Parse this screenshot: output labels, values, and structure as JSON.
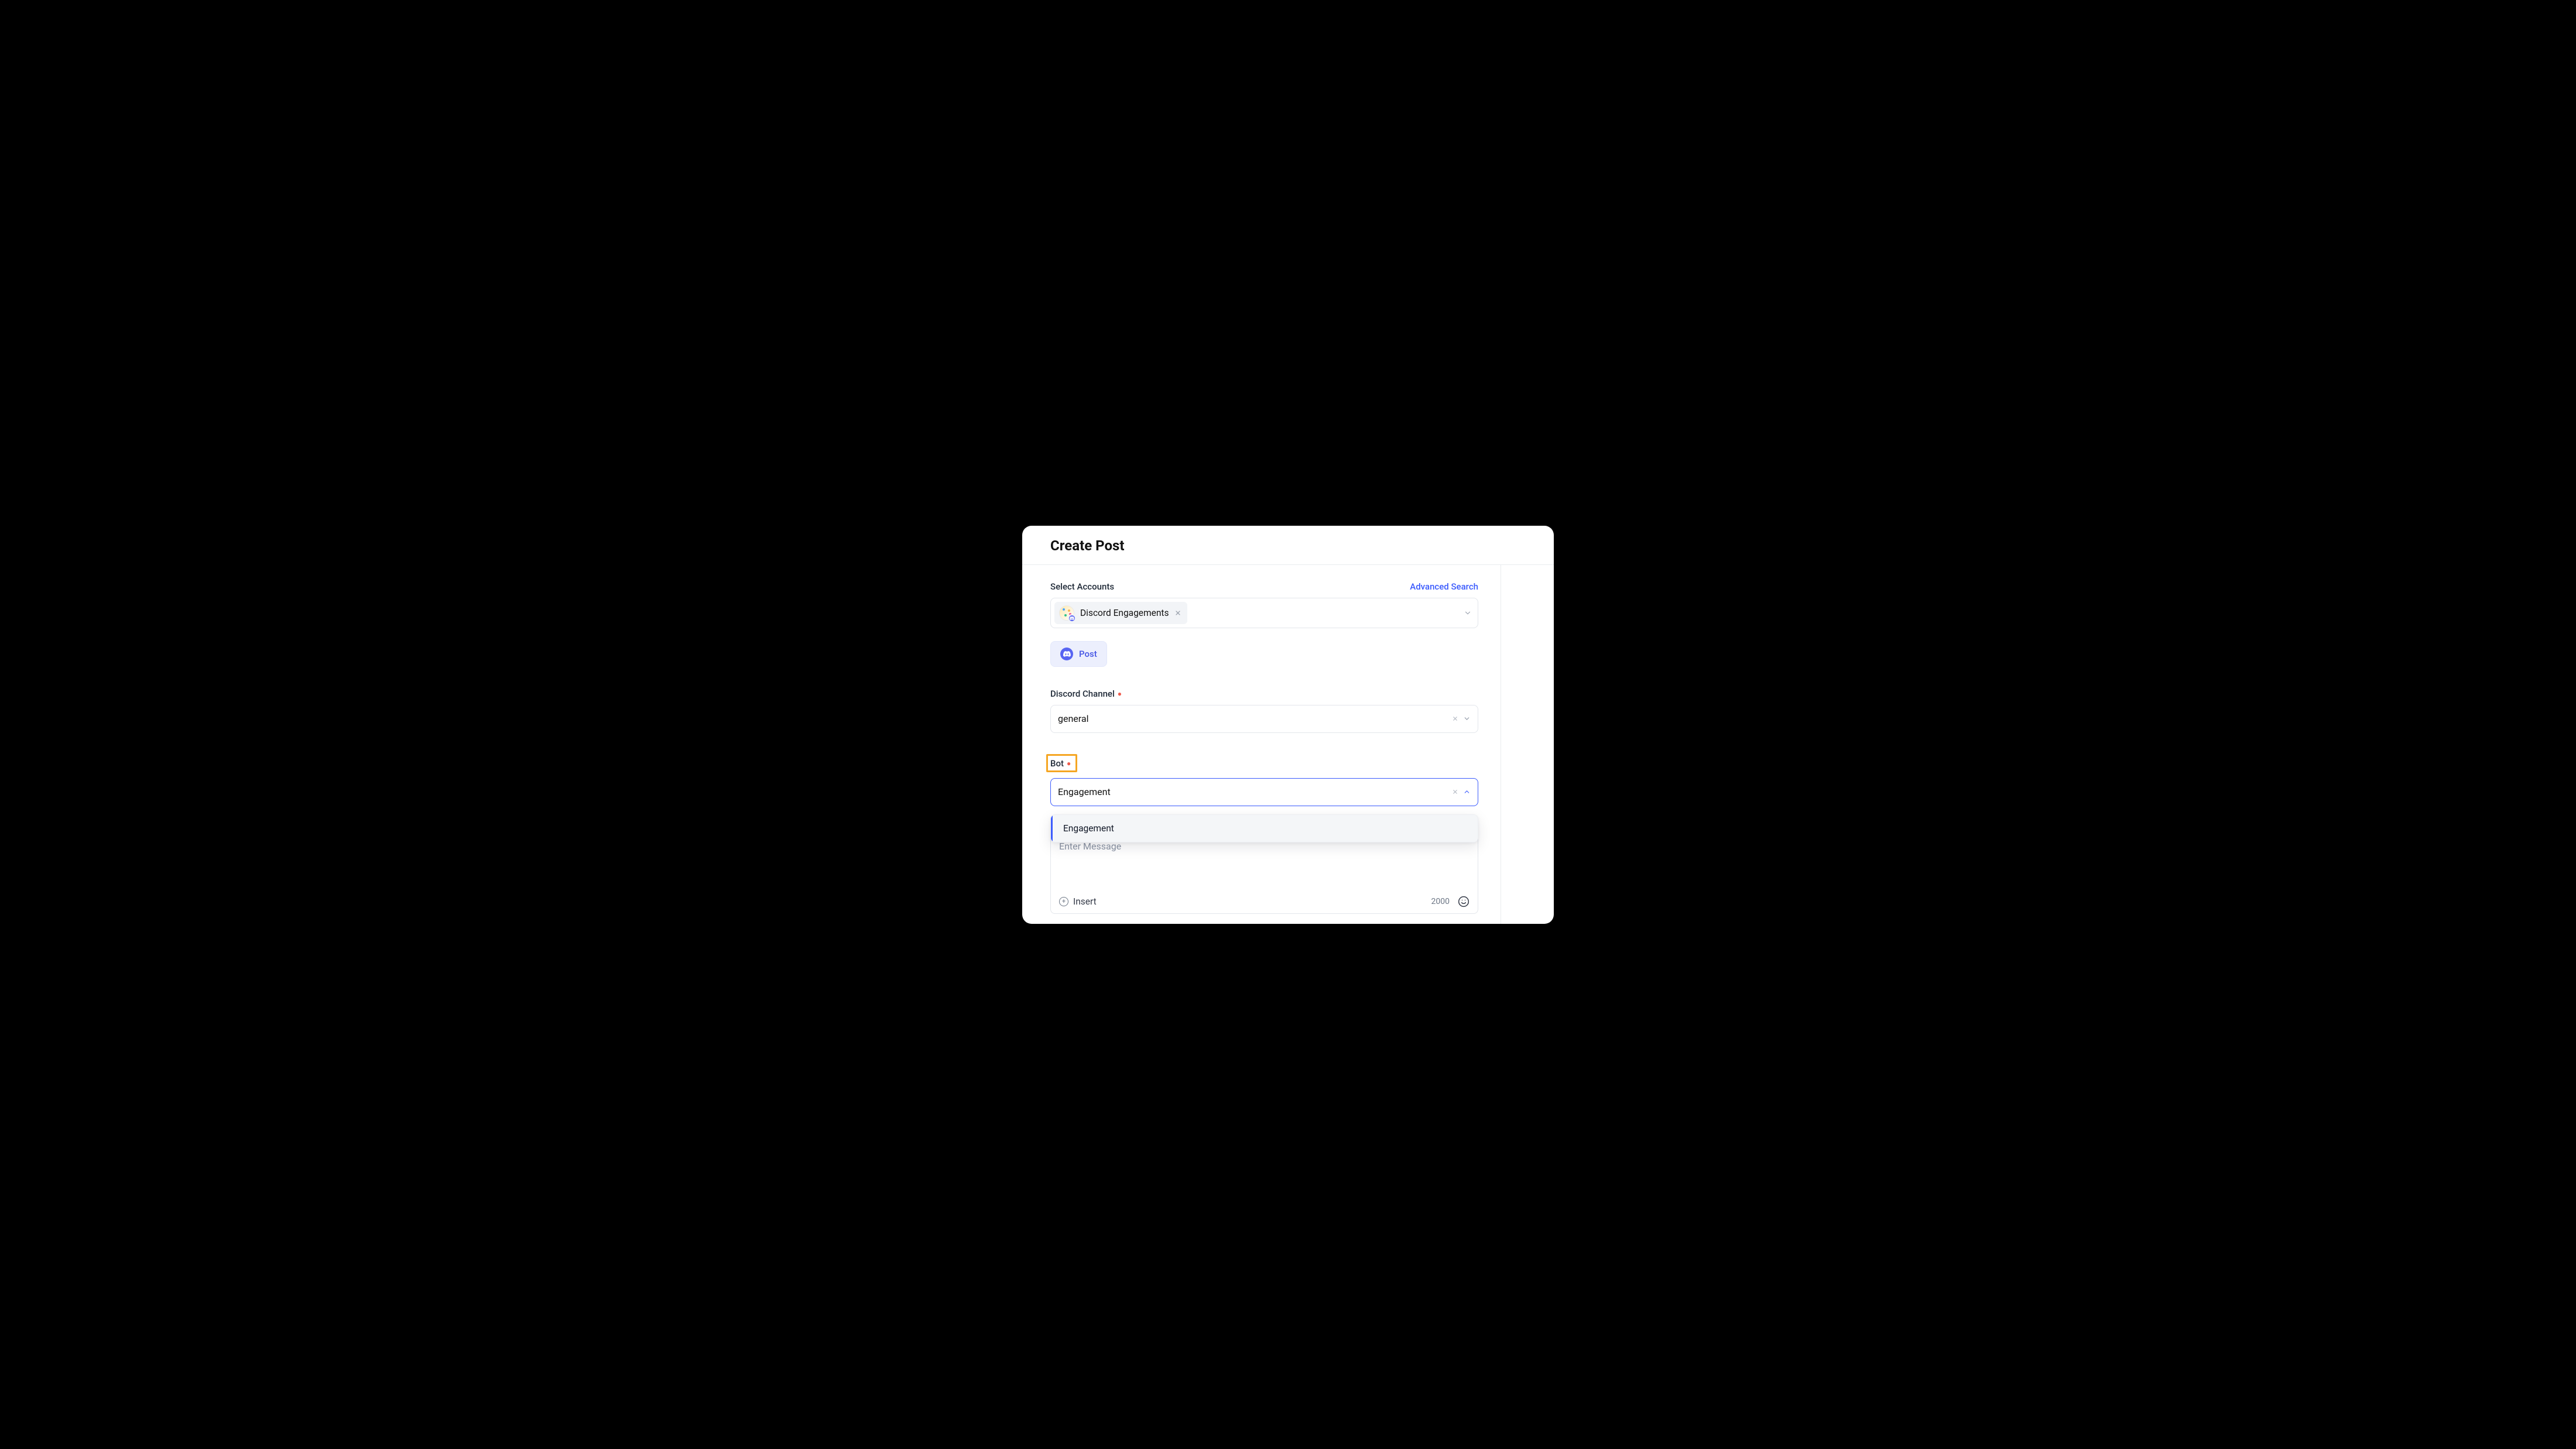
{
  "header": {
    "title": "Create Post"
  },
  "accounts": {
    "label": "Select Accounts",
    "advanced": "Advanced Search",
    "selected": {
      "name": "Discord Engagements"
    }
  },
  "postType": {
    "label": "Post"
  },
  "channel": {
    "label": "Discord Channel",
    "value": "general"
  },
  "bot": {
    "label": "Bot",
    "value": "Engagement",
    "options": [
      "Engagement"
    ]
  },
  "message": {
    "placeholder": "Enter Message",
    "insert": "Insert",
    "charLimit": "2000"
  }
}
